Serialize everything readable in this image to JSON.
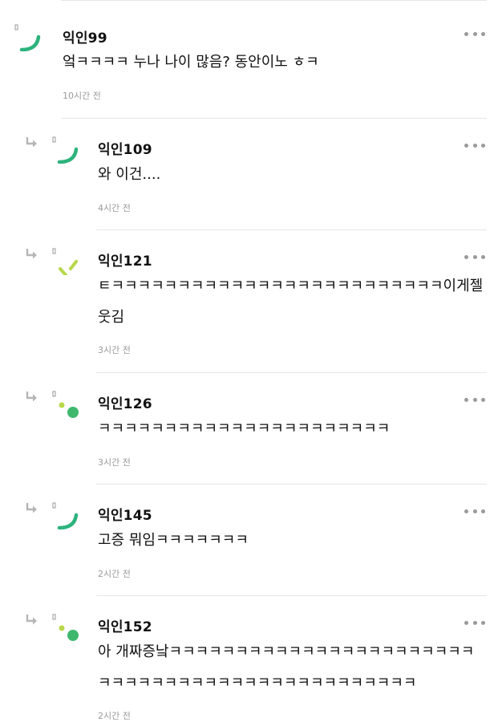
{
  "comments": [
    {
      "nickname": "익인99",
      "text": "엌ㅋㅋㅋㅋ 누나 나이 많음? 동안이노 ㅎㅋ",
      "time": "10시간 전",
      "avatar_icon": "green-arc-icon",
      "is_reply": false
    },
    {
      "nickname": "익인109",
      "text": "와 이건....",
      "time": "4시간 전",
      "avatar_icon": "green-arc-icon",
      "is_reply": true
    },
    {
      "nickname": "익인121",
      "text": "ㅌㅋㅋㅋㅋㅋㅋㅋㅋㅋㅋㅋㅋㅋㅋㅋㅋㅋㅋㅋㅋㅋㅋㅋㅋㅋ이게젤웃김",
      "time": "3시간 전",
      "avatar_icon": "lime-slash-icon",
      "is_reply": true
    },
    {
      "nickname": "익인126",
      "text": "ㅋㅋㅋㅋㅋㅋㅋㅋㅋㅋㅋㅋㅋㅋㅋㅋㅋㅋㅋㅋㅋㅋ",
      "time": "3시간 전",
      "avatar_icon": "green-dot-icon",
      "is_reply": true
    },
    {
      "nickname": "익인145",
      "text": "고증 뭐임ㅋㅋㅋㅋㅋㅋㅋ",
      "time": "2시간 전",
      "avatar_icon": "green-arc-icon",
      "is_reply": true
    },
    {
      "nickname": "익인152",
      "text": "아 개짜증낰ㅋㅋㅋㅋㅋㅋㅋㅋㅋㅋㅋㅋㅋㅋㅋㅋㅋㅋㅋㅋㅋㅋㅋㅋㅋㅋㅋㅋㅋㅋㅋㅋㅋㅋㅋㅋㅋㅋㅋㅋㅋㅋㅋㅋㅋㅋㅋ",
      "time": "2시간 전",
      "avatar_icon": "green-dot-icon",
      "is_reply": true
    }
  ],
  "colors": {
    "accent_green": "#2db37c",
    "lime": "#b8d84a",
    "muted": "#9a9a9a",
    "divider": "#e6e6e6"
  }
}
